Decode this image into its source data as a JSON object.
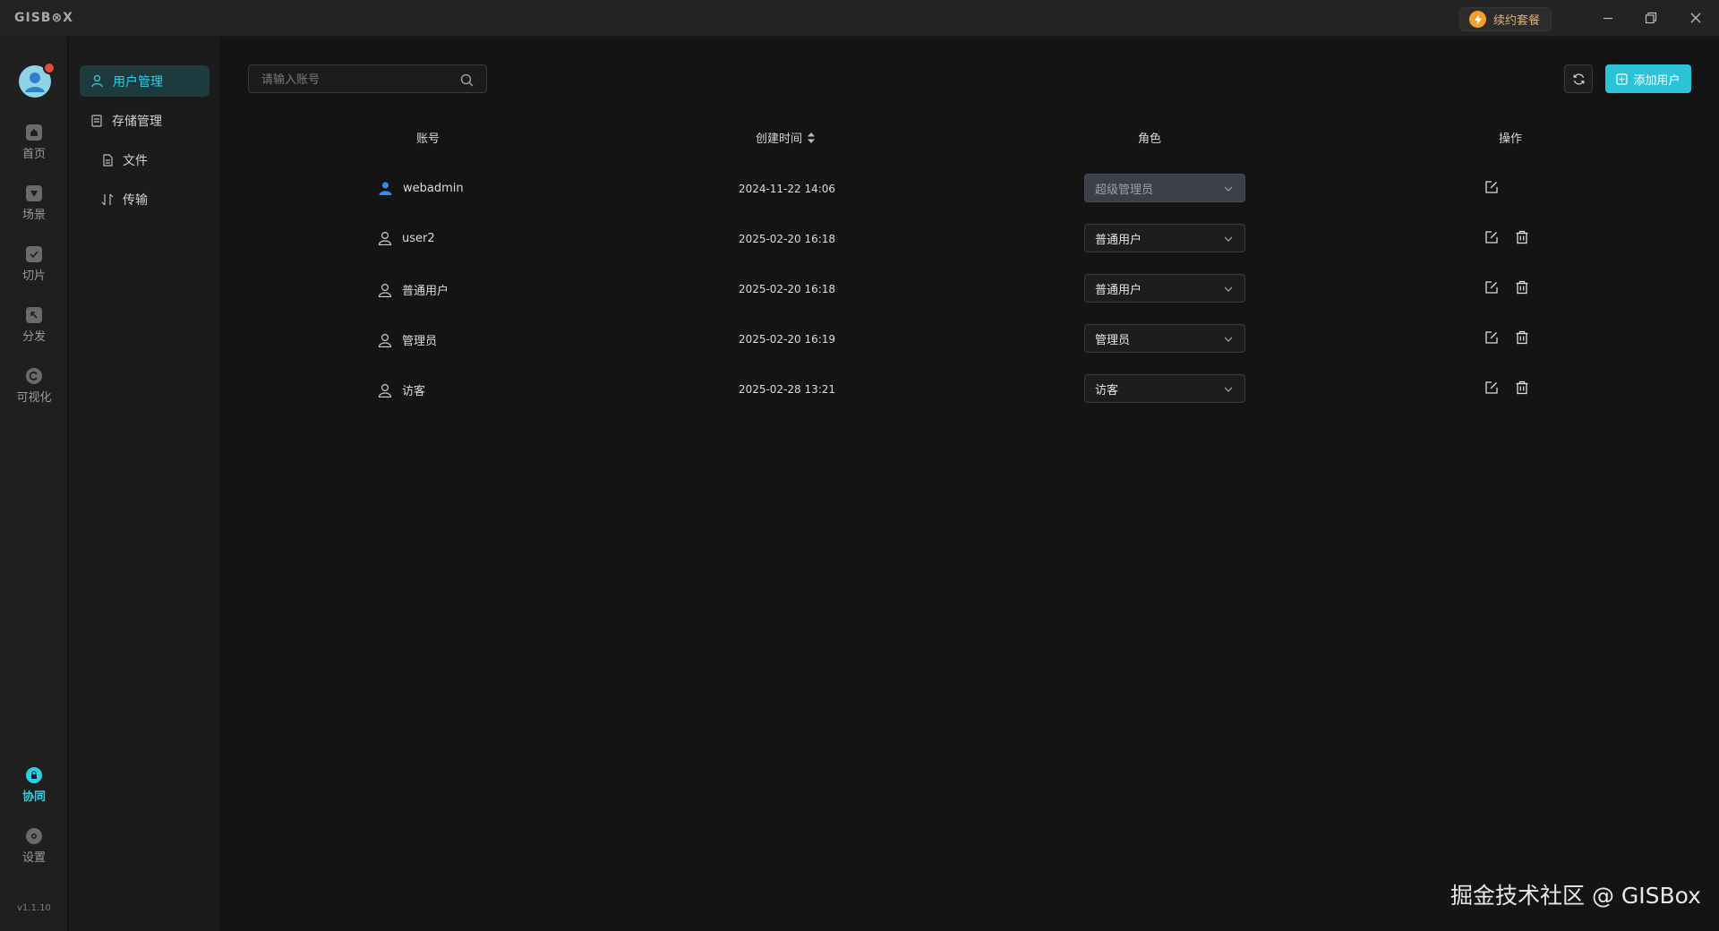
{
  "app": {
    "logo": "GISB⊗X"
  },
  "titlebar": {
    "renew_label": "续约套餐"
  },
  "rail": {
    "items": [
      {
        "label": "首页",
        "icon": "home-icon"
      },
      {
        "label": "场景",
        "icon": "scene-icon"
      },
      {
        "label": "切片",
        "icon": "tile-icon"
      },
      {
        "label": "分发",
        "icon": "publish-icon"
      },
      {
        "label": "可视化",
        "icon": "visualize-icon"
      }
    ],
    "bottom": [
      {
        "label": "协同",
        "icon": "collab-icon",
        "active": true
      },
      {
        "label": "设置",
        "icon": "gear-icon"
      }
    ],
    "version": "v1.1.10"
  },
  "submenu": {
    "items": [
      {
        "label": "用户管理",
        "active": true
      },
      {
        "label": "存储管理"
      },
      {
        "label": "文件"
      },
      {
        "label": "传输"
      }
    ]
  },
  "toolbar": {
    "search_placeholder": "请输入账号",
    "add_user_label": "添加用户"
  },
  "table": {
    "headers": [
      "账号",
      "创建时间",
      "角色",
      "操作"
    ],
    "rows": [
      {
        "account": "webadmin",
        "created": "2024-11-22 14:06",
        "role": "超级管理员",
        "role_locked": true
      },
      {
        "account": "user2",
        "created": "2025-02-20 16:18",
        "role": "普通用户"
      },
      {
        "account": "普通用户",
        "created": "2025-02-20 16:18",
        "role": "普通用户"
      },
      {
        "account": "管理员",
        "created": "2025-02-20 16:19",
        "role": "管理员"
      },
      {
        "account": "访客",
        "created": "2025-02-28 13:21",
        "role": "访客"
      }
    ]
  },
  "watermark": "掘金技术社区 @ GISBox",
  "colors": {
    "accent": "#2dd0e3",
    "add_button": "#2bc3d8",
    "renew_text": "#d9b07b",
    "active_user_icon": "#2f8ff0"
  }
}
